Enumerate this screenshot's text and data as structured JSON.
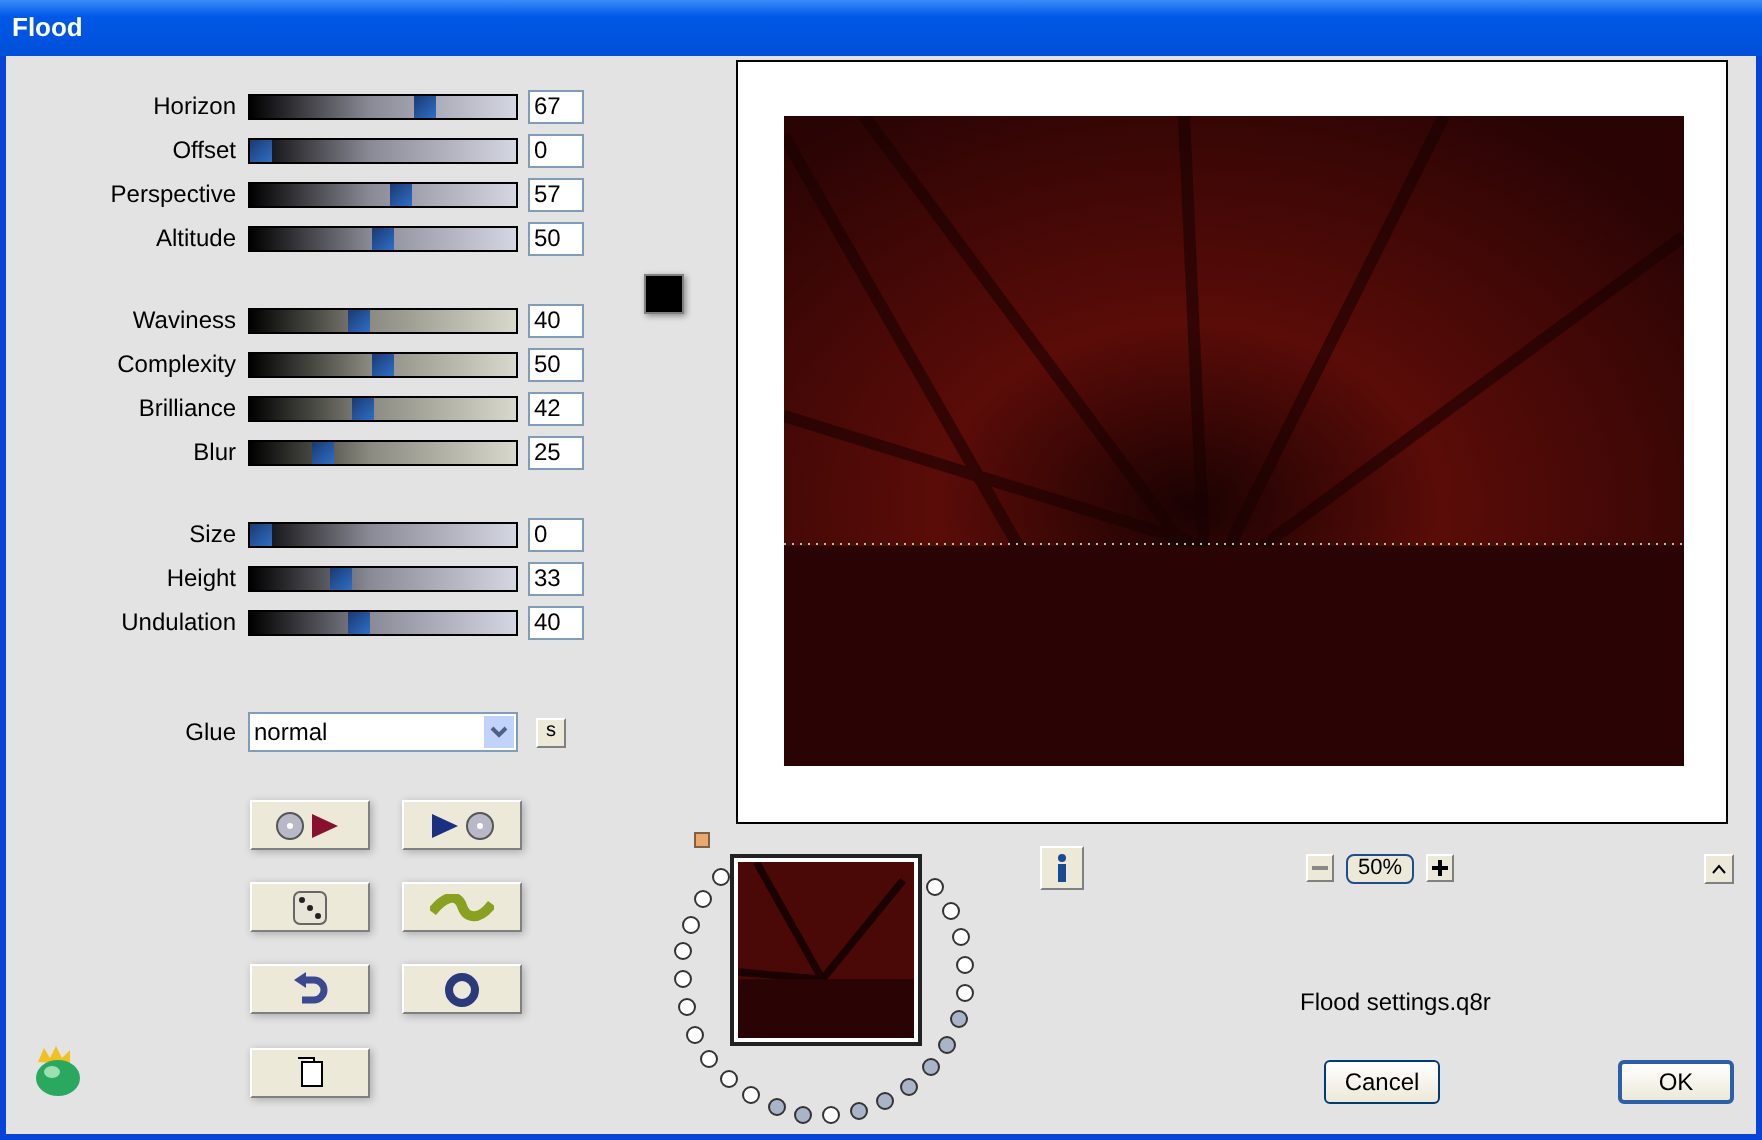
{
  "window": {
    "title": "Flood"
  },
  "slider_groups": [
    [
      {
        "label": "Horizon",
        "value": "67",
        "level": 0.67
      },
      {
        "label": "Offset",
        "value": "0",
        "level": 0
      },
      {
        "label": "Perspective",
        "value": "57",
        "level": 0.57
      },
      {
        "label": "Altitude",
        "value": "50",
        "level": 0.5
      }
    ],
    [
      {
        "label": "Waviness",
        "value": "40",
        "level": 0.4
      },
      {
        "label": "Complexity",
        "value": "50",
        "level": 0.5
      },
      {
        "label": "Brilliance",
        "value": "42",
        "level": 0.42
      },
      {
        "label": "Blur",
        "value": "25",
        "level": 0.25
      }
    ],
    [
      {
        "label": "Size",
        "value": "0",
        "level": 0
      },
      {
        "label": "Height",
        "value": "33",
        "level": 0.33
      },
      {
        "label": "Undulation",
        "value": "40",
        "level": 0.4
      }
    ]
  ],
  "color_swatch": {
    "color": "#000000"
  },
  "glue": {
    "label": "Glue",
    "value": "normal",
    "side_button": "s"
  },
  "zoom": {
    "value": "50%"
  },
  "presets": [
    {
      "filled": false
    },
    {
      "filled": false
    },
    {
      "filled": false
    },
    {
      "filled": false
    },
    {
      "filled": false
    },
    {
      "filled": false
    },
    {
      "filled": false
    },
    {
      "filled": false
    },
    {
      "filled": false
    },
    {
      "filled": false
    },
    {
      "filled": true
    },
    {
      "filled": true
    },
    {
      "filled": false
    },
    {
      "filled": true
    },
    {
      "filled": true
    },
    {
      "filled": true
    },
    {
      "filled": true
    },
    {
      "filled": true
    },
    {
      "filled": true
    },
    {
      "filled": false
    },
    {
      "filled": false
    },
    {
      "filled": false
    },
    {
      "filled": false
    },
    {
      "filled": false
    }
  ],
  "settings_file": "Flood settings.q8r",
  "buttons": [
    {
      "label": "Cancel",
      "default": false
    },
    {
      "label": "OK",
      "default": true
    }
  ]
}
